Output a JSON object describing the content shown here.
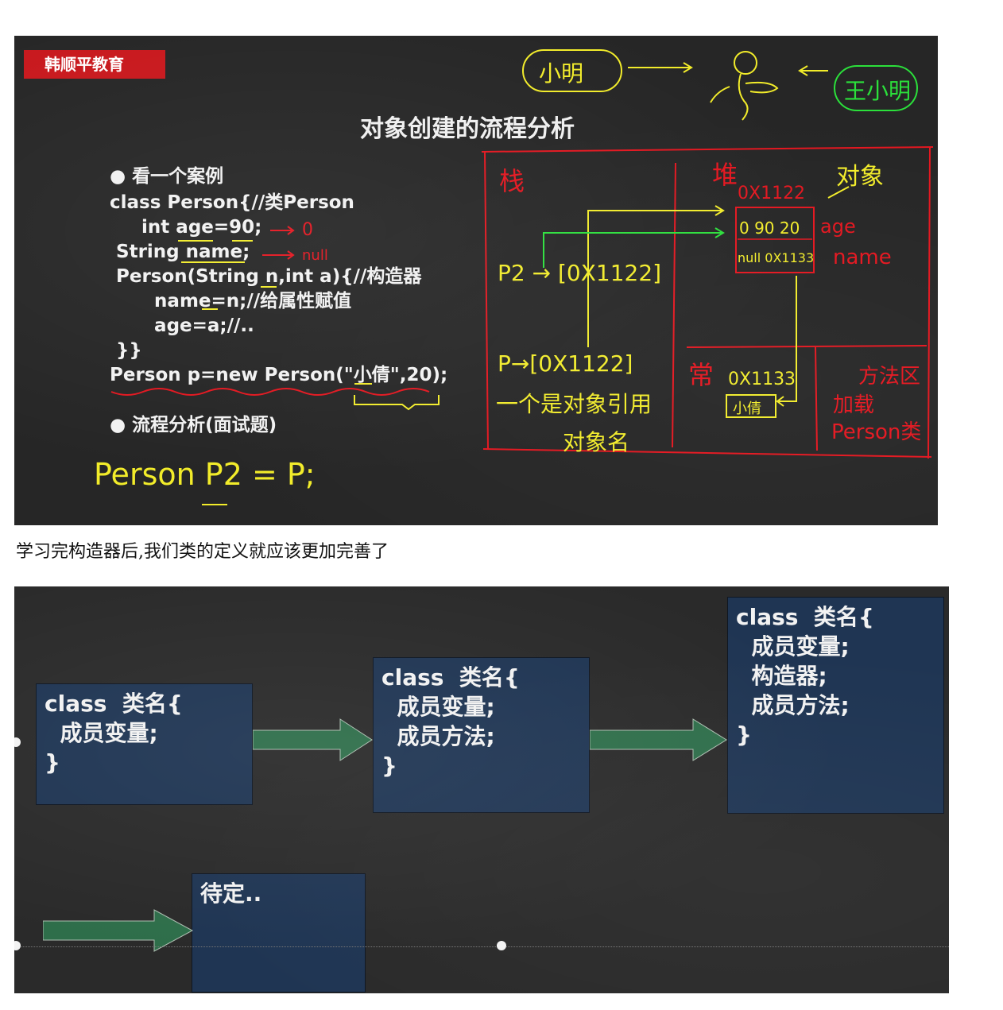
{
  "slide1": {
    "brand": "韩顺平教育",
    "title": "对象创建的流程分析",
    "bullet1": "看一个案例",
    "code_lines": [
      "class Person{//类Person",
      "     int age=90;",
      " String name;",
      " Person(String n,int a){//构造器",
      "       name=n;//给属性赋值",
      "       age=a;//..",
      " }}",
      "Person p=new Person(\"小倩\",20);"
    ],
    "bullet2": "流程分析(面试题)",
    "handwriting": {
      "xiaoming": "小明",
      "wangxiaoming": "王小明",
      "zhan": "栈",
      "dui": "堆",
      "duixiang": "对象",
      "addr_0x1122": "0X1122",
      "addr_0x1122_b": "0X1122",
      "age_val": "0 90 20",
      "age_label": "age",
      "name_val": "null 0X1133",
      "name_label": "name",
      "p2_ref": "P2 → [0X1122]",
      "p_ref": "P→[0X1122]",
      "yinyong": "一个是对象引用",
      "duixiangming": "对象名",
      "chang": "常",
      "addr_0x1133": "0X1133",
      "xiaoqian": "小倩",
      "fangfaqu": "方法区",
      "jiazai": "加载",
      "person_class": "Person类",
      "zero": "0",
      "null_note": "null",
      "formula": "Person P2 = P;"
    }
  },
  "caption": "学习完构造器后,我们类的定义就应该更加完善了",
  "slide2": {
    "box1": "class  类名{\n  成员变量;\n}",
    "box2": "class  类名{\n  成员变量;\n  成员方法;\n}",
    "box3": "class  类名{\n  成员变量;\n  构造器;\n  成员方法;\n}",
    "box4": "待定.."
  },
  "colors": {
    "brand_red": "#c8181d",
    "chalk_red": "#e4161f",
    "chalk_yellow": "#f2ec2a",
    "chalk_green": "#2be03b",
    "box_blue": "#1f3553",
    "arrow_green": "#2e6e4a"
  }
}
